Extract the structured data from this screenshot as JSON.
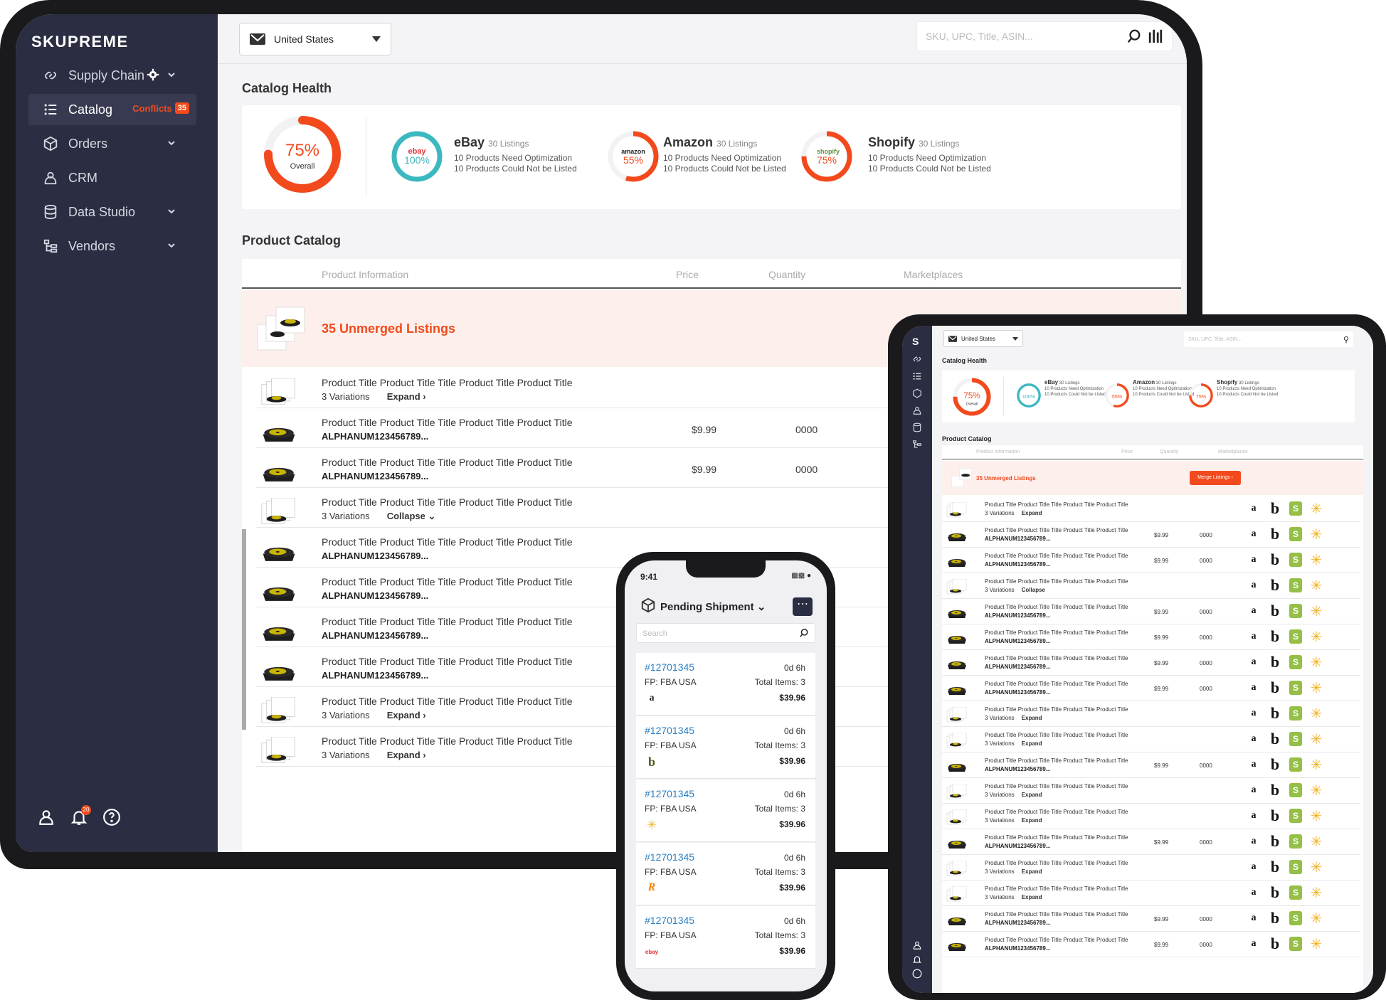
{
  "brand": "SKUPREME",
  "sidebar": {
    "items": [
      {
        "label": "Supply Chain"
      },
      {
        "label": "Catalog",
        "badge_label": "Conflicts",
        "badge_count": "35"
      },
      {
        "label": "Orders"
      },
      {
        "label": "CRM"
      },
      {
        "label": "Data Studio"
      },
      {
        "label": "Vendors"
      }
    ],
    "notification_count": "20"
  },
  "topbar": {
    "country": "United States",
    "search_placeholder": "SKU, UPC, Title, ASIN..."
  },
  "catalog_health": {
    "title": "Catalog Health",
    "overall": {
      "percent": "75%",
      "label": "Overall",
      "value": 0.75
    },
    "marketplaces": [
      {
        "name": "eBay",
        "logo": "ebay",
        "listings": "30 Listings",
        "percent": "100%",
        "value": 1.0,
        "color": "#3cb8c0",
        "line1": "10 Products Need Optimization",
        "line2": "10 Products Could Not be Listed"
      },
      {
        "name": "Amazon",
        "logo": "amazon",
        "listings": "30 Listings",
        "percent": "55%",
        "value": 0.55,
        "color": "#f24a1d",
        "line1": "10 Products Need Optimization",
        "line2": "10 Products Could Not be Listed"
      },
      {
        "name": "Shopify",
        "logo": "shopify",
        "listings": "30 Listings",
        "percent": "75%",
        "value": 0.75,
        "color": "#f24a1d",
        "line1": "10 Products Need Optimization",
        "line2": "10 Products Could Not be Listed"
      }
    ]
  },
  "product_catalog": {
    "title": "Product Catalog",
    "columns": [
      "Product Information",
      "Price",
      "Quantity",
      "Marketplaces"
    ],
    "unmerged": "35 Unmerged Listings",
    "merge_button": "Merge Listings",
    "rows": [
      {
        "type": "group",
        "title": "Product Title Product Title Title Product Title Product Title",
        "variations": "3 Variations",
        "action": "Expand"
      },
      {
        "type": "item",
        "title": "Product Title Product Title Title Product Title Product Title",
        "sku": "ALPHANUM123456789...",
        "price": "$9.99",
        "qty": "0000"
      },
      {
        "type": "item",
        "title": "Product Title Product Title Title Product Title Product Title",
        "sku": "ALPHANUM123456789...",
        "price": "$9.99",
        "qty": "0000"
      },
      {
        "type": "group",
        "title": "Product Title Product Title Title Product Title Product Title",
        "variations": "3 Variations",
        "action": "Collapse"
      },
      {
        "type": "item",
        "title": "Product Title Product Title Title Product Title Product Title",
        "sku": "ALPHANUM123456789...",
        "price": "",
        "qty": ""
      },
      {
        "type": "item",
        "title": "Product Title Product Title Title Product Title Product Title",
        "sku": "ALPHANUM123456789...",
        "price": "",
        "qty": ""
      },
      {
        "type": "item",
        "title": "Product Title Product Title Title Product Title Product Title",
        "sku": "ALPHANUM123456789...",
        "price": "",
        "qty": ""
      },
      {
        "type": "item",
        "title": "Product Title Product Title Title Product Title Product Title",
        "sku": "ALPHANUM123456789...",
        "price": "",
        "qty": ""
      },
      {
        "type": "group",
        "title": "Product Title Product Title Title Product Title Product Title",
        "variations": "3 Variations",
        "action": "Expand"
      },
      {
        "type": "group",
        "title": "Product Title Product Title Title Product Title Product Title",
        "variations": "3 Variations",
        "action": "Expand"
      }
    ]
  },
  "tablet": {
    "logo": "S",
    "country": "United States",
    "search_placeholder": "SKU, UPC, Title, ASIN...",
    "rows": [
      {
        "type": "group",
        "title": "Product Title Product Title Title Product Title Product Title",
        "variations": "3 Variations",
        "action": "Expand",
        "price": "",
        "qty": ""
      },
      {
        "type": "item",
        "title": "Product Title Product Title Title Product Title Product Title",
        "sku": "ALPHANUM123456789...",
        "price": "$9.99",
        "qty": "0000"
      },
      {
        "type": "item",
        "title": "Product Title Product Title Title Product Title Product Title",
        "sku": "ALPHANUM123456789...",
        "price": "$9.99",
        "qty": "0000"
      },
      {
        "type": "group",
        "title": "Product Title Product Title Title Product Title Product Title",
        "variations": "3 Variations",
        "action": "Collapse",
        "price": "",
        "qty": ""
      },
      {
        "type": "item",
        "title": "Product Title Product Title Title Product Title Product Title",
        "sku": "ALPHANUM123456789...",
        "price": "$9.99",
        "qty": "0000"
      },
      {
        "type": "item",
        "title": "Product Title Product Title Title Product Title Product Title",
        "sku": "ALPHANUM123456789...",
        "price": "$9.99",
        "qty": "0000"
      },
      {
        "type": "item",
        "title": "Product Title Product Title Title Product Title Product Title",
        "sku": "ALPHANUM123456789...",
        "price": "$9.99",
        "qty": "0000"
      },
      {
        "type": "item",
        "title": "Product Title Product Title Title Product Title Product Title",
        "sku": "ALPHANUM123456789...",
        "price": "$9.99",
        "qty": "0000"
      },
      {
        "type": "group",
        "title": "Product Title Product Title Title Product Title Product Title",
        "variations": "3 Variations",
        "action": "Expand",
        "price": "",
        "qty": ""
      },
      {
        "type": "group",
        "title": "Product Title Product Title Title Product Title Product Title",
        "variations": "3 Variations",
        "action": "Expand",
        "price": "",
        "qty": ""
      },
      {
        "type": "item",
        "title": "Product Title Product Title Title Product Title Product Title",
        "sku": "ALPHANUM123456789...",
        "price": "$9.99",
        "qty": "0000"
      },
      {
        "type": "group",
        "title": "Product Title Product Title Title Product Title Product Title",
        "variations": "3 Variations",
        "action": "Expand",
        "price": "",
        "qty": ""
      },
      {
        "type": "group",
        "title": "Product Title Product Title Title Product Title Product Title",
        "variations": "3 Variations",
        "action": "Expand",
        "price": "",
        "qty": ""
      },
      {
        "type": "item",
        "title": "Product Title Product Title Title Product Title Product Title",
        "sku": "ALPHANUM123456789...",
        "price": "$9.99",
        "qty": "0000"
      },
      {
        "type": "group",
        "title": "Product Title Product Title Title Product Title Product Title",
        "variations": "3 Variations",
        "action": "Expand",
        "price": "",
        "qty": ""
      },
      {
        "type": "group",
        "title": "Product Title Product Title Title Product Title Product Title",
        "variations": "3 Variations",
        "action": "Expand",
        "price": "",
        "qty": ""
      },
      {
        "type": "item",
        "title": "Product Title Product Title Title Product Title Product Title",
        "sku": "ALPHANUM123456789...",
        "price": "$9.99",
        "qty": "0000"
      },
      {
        "type": "item",
        "title": "Product Title Product Title Title Product Title Product Title",
        "sku": "ALPHANUM123456789...",
        "price": "$9.99",
        "qty": "0000"
      }
    ]
  },
  "phone": {
    "time": "9:41",
    "title": "Pending Shipment",
    "search_placeholder": "Search",
    "orders": [
      {
        "id": "#12701345",
        "age": "0d 6h",
        "fp": "FP: FBA USA",
        "items": "Total Items: 3",
        "amount": "$39.96",
        "marketplace": "amazon"
      },
      {
        "id": "#12701345",
        "age": "0d 6h",
        "fp": "FP: FBA USA",
        "items": "Total Items: 3",
        "amount": "$39.96",
        "marketplace": "bonanza"
      },
      {
        "id": "#12701345",
        "age": "0d 6h",
        "fp": "FP: FBA USA",
        "items": "Total Items: 3",
        "amount": "$39.96",
        "marketplace": "walmart"
      },
      {
        "id": "#12701345",
        "age": "0d 6h",
        "fp": "FP: FBA USA",
        "items": "Total Items: 3",
        "amount": "$39.96",
        "marketplace": "reverb"
      },
      {
        "id": "#12701345",
        "age": "0d 6h",
        "fp": "FP: FBA USA",
        "items": "Total Items: 3",
        "amount": "$39.96",
        "marketplace": "ebay"
      }
    ]
  },
  "colors": {
    "accent": "#f24a1d",
    "sidebar": "#2b2d42",
    "ebay_ring": "#3cb8c0",
    "link": "#2a7fc4"
  }
}
